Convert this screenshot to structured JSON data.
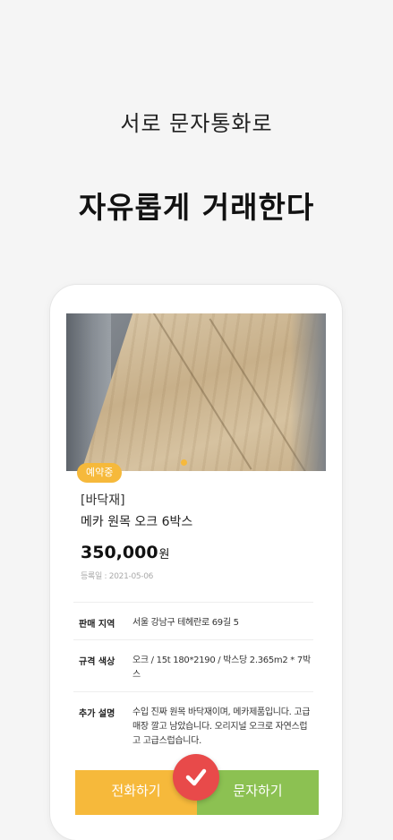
{
  "promo": {
    "subtitle": "서로 문자통화로",
    "headline": "자유롭게 거래한다"
  },
  "listing": {
    "status_badge": "예약중",
    "category": "[바닥재]",
    "title": "메카 원목 오크 6박스",
    "price": "350,000",
    "price_unit": "원",
    "registered": "등록일 : 2021-05-06",
    "details": [
      {
        "label": "판매 지역",
        "value": "서울 강남구 테헤란로 69길 5"
      },
      {
        "label": "규격 색상",
        "value": "오크 / 15t 180*2190 / 박스당 2.365m2 * 7박스"
      },
      {
        "label": "추가 설명",
        "value": "수입 진짜 원목 바닥재이며, 메카제품입니다. 고급매장 깔고 남았습니다. 오리지널 오크로 자연스럽고 고급스럽습니다."
      }
    ]
  },
  "actions": {
    "call_label": "전화하기",
    "sms_label": "문자하기"
  },
  "colors": {
    "accent_yellow": "#f6b93b",
    "accent_green": "#8cc152",
    "check_red": "#e84a4a"
  },
  "icons": {
    "check": "check-icon"
  }
}
